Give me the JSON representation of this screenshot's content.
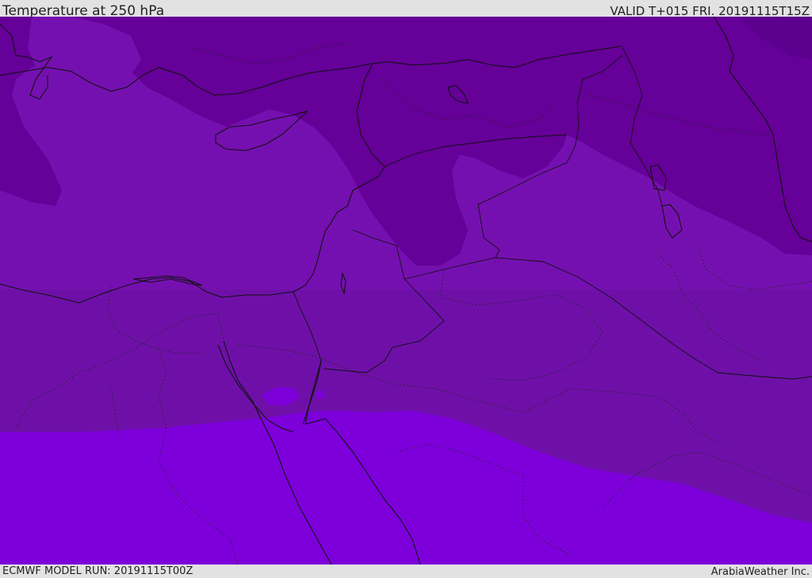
{
  "header": {
    "title": "Temperature at 250 hPa",
    "valid": "VALID T+015 FRI. 20191115T15Z"
  },
  "footer": {
    "model_run": "ECMWF MODEL RUN: 20191115T00Z",
    "credit": "ArabiaWeather Inc."
  },
  "colors": {
    "band_coldest": "#5c0090",
    "band_cold": "#650098",
    "band_mid": "#7510b0",
    "band_warm": "#6e10a8",
    "band_warmest": "#7d00db",
    "lines": "#111111"
  }
}
